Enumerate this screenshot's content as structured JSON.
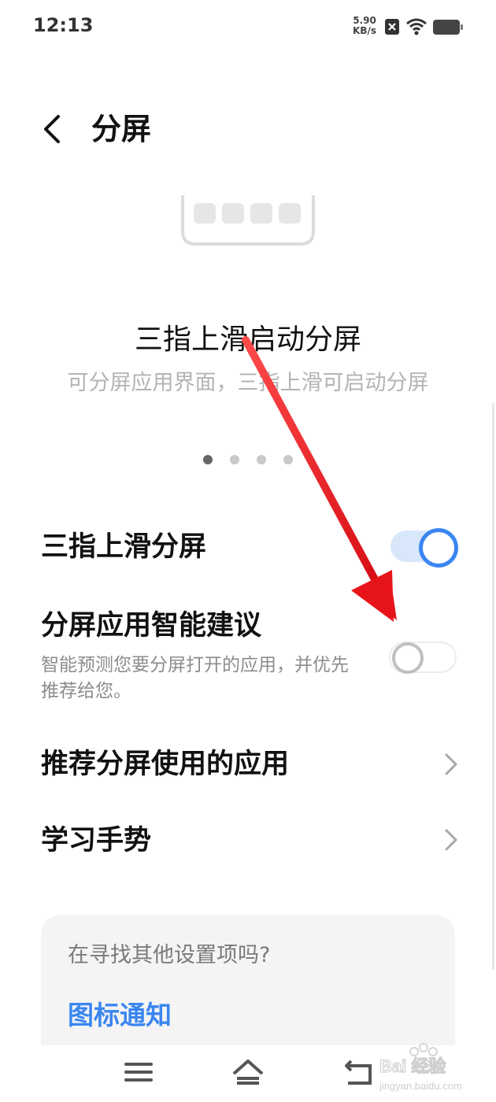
{
  "status_bar": {
    "time": "12:13",
    "speed_value": "5.90",
    "speed_unit": "KB/s",
    "icons": [
      "notification-x-icon",
      "wifi-icon",
      "battery-icon"
    ]
  },
  "header": {
    "title": "分屏",
    "back_icon": "back-arrow-icon"
  },
  "feature": {
    "title": "三指上滑启动分屏",
    "description": "可分屏应用界面，三指上滑可启动分屏",
    "page_count": 4,
    "active_page": 1
  },
  "settings": {
    "three_finger": {
      "label": "三指上滑分屏",
      "enabled": true
    },
    "smart_suggest": {
      "label": "分屏应用智能建议",
      "description": "智能预测您要分屏打开的应用，并优先推荐给您。",
      "enabled": false
    },
    "recommended_apps": {
      "label": "推荐分屏使用的应用"
    },
    "learn_gesture": {
      "label": "学习手势"
    }
  },
  "other_settings": {
    "title": "在寻找其他设置项吗?",
    "link": "图标通知"
  },
  "nav_bar": {
    "icons": [
      "menu-icon",
      "home-icon",
      "back-icon"
    ]
  },
  "watermark": {
    "text": "Bai 经验",
    "url_text": "jingyan.baidu.com"
  },
  "colors": {
    "accent": "#3a86f1",
    "arrow": "#e8141b"
  }
}
